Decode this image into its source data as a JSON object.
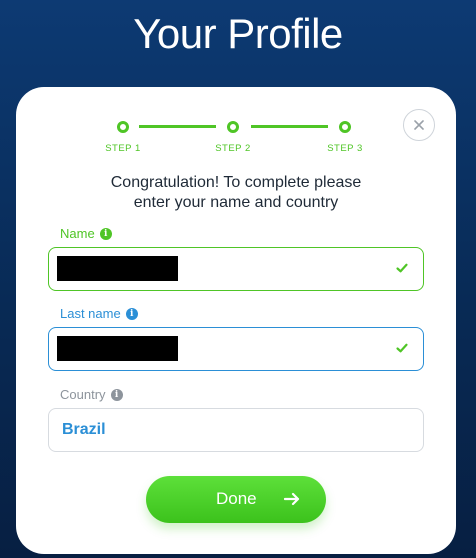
{
  "page": {
    "title": "Your Profile"
  },
  "stepper": {
    "steps": [
      {
        "label": "STEP 1"
      },
      {
        "label": "STEP 2"
      },
      {
        "label": "STEP 3"
      }
    ]
  },
  "intro": {
    "line1": "Congratulation! To complete please",
    "line2": "enter your name and country"
  },
  "form": {
    "name": {
      "label": "Name",
      "value": "",
      "status": "valid"
    },
    "last_name": {
      "label": "Last name",
      "value": "",
      "status": "valid"
    },
    "country": {
      "label": "Country",
      "value": "Brazil"
    }
  },
  "actions": {
    "done_label": "Done"
  },
  "icons": {
    "close": "close-icon",
    "info": "info-icon",
    "check": "check-icon",
    "arrow": "arrow-right-icon"
  },
  "colors": {
    "background": "#0b3366",
    "accent_green": "#4fc526",
    "accent_blue": "#2b8fd6",
    "muted_gray": "#8d949c"
  }
}
